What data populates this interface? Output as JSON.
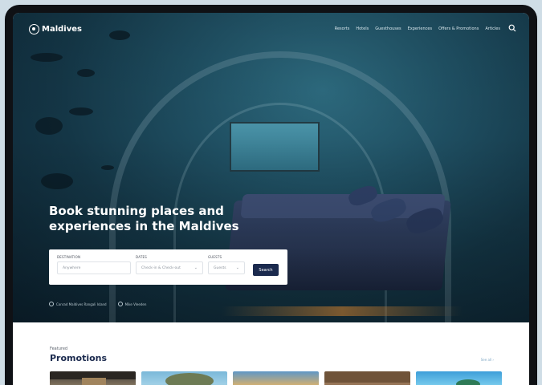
{
  "nav": {
    "brand": "Maldives",
    "links": [
      "Resorts",
      "Hotels",
      "Guesthouses",
      "Experiences",
      "Offers & Promotions",
      "Articles"
    ],
    "search_icon": "search-icon"
  },
  "hero": {
    "headline_line1": "Book stunning places and",
    "headline_line2": "experiences in the Maldives",
    "search": {
      "destination_label": "DESTINATION",
      "destination_placeholder": "Anywhere",
      "dates_label": "DATES",
      "dates_value": "Check-in & Check-out",
      "guests_label": "GUESTS",
      "guests_value": "Guests",
      "button_label": "Search"
    },
    "credits": [
      "Conrad Maldives Rangali Island",
      "Mike Vleeden"
    ]
  },
  "featured": {
    "eyebrow": "Featured",
    "title": "Promotions",
    "see_all": "See all ›",
    "cards": [
      "promo-1",
      "promo-2",
      "promo-3",
      "promo-4",
      "promo-5"
    ]
  }
}
